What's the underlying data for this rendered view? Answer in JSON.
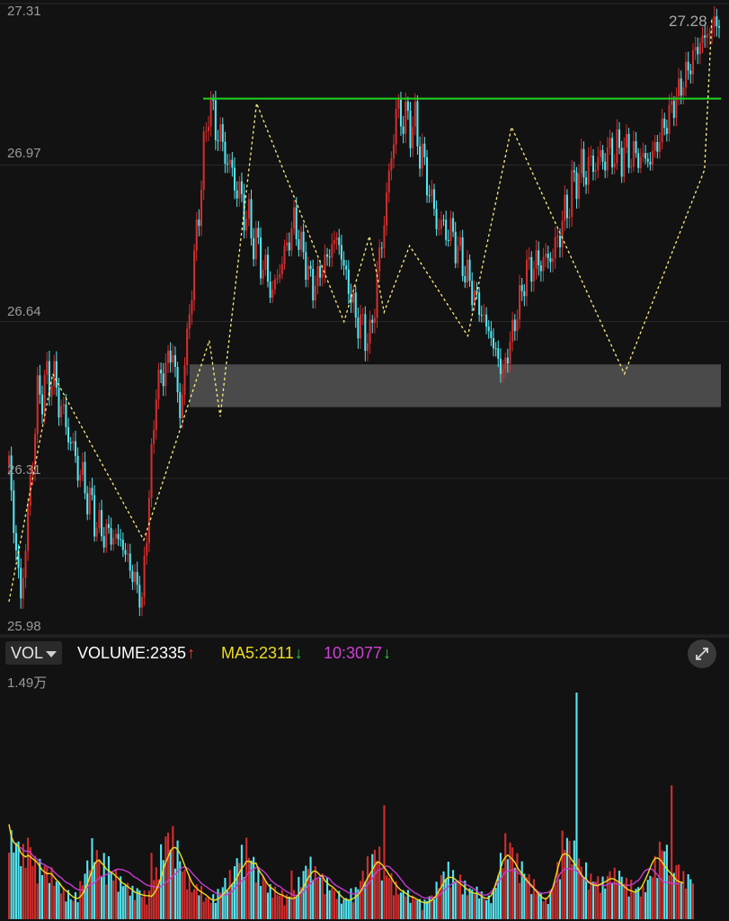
{
  "price_axis": {
    "labels": [
      "27.31",
      "26.97",
      "26.64",
      "26.31",
      "25.98"
    ],
    "ylim": [
      25.98,
      27.31
    ]
  },
  "last_price_label": "27.28",
  "volume_unit_label": "1.49万",
  "indicators": {
    "selector_label": "VOL",
    "volume": {
      "label": "VOLUME:2335",
      "arrow": "↑",
      "color": "#ffffff",
      "arrow_color": "#ff3b30"
    },
    "ma5": {
      "label": "MA5:2311",
      "arrow": "↓",
      "color": "#f0dc1e",
      "arrow_color": "#2ecc40"
    },
    "ma10": {
      "label": "10:3077",
      "arrow": "↓",
      "color": "#d13fd6",
      "arrow_color": "#2ecc40"
    }
  },
  "colors": {
    "up": "#d42d2d",
    "down": "#55e6f0",
    "resistance": "#1fd51f",
    "zone": "#4a4a4a",
    "zigzag": "#ffef80",
    "ma5": "#f0dc1e",
    "ma10": "#c63bd0",
    "grid": "#2a2a2a"
  },
  "chart_data": [
    {
      "type": "line",
      "name": "price-chart",
      "title": "",
      "ylim": [
        25.98,
        27.31
      ],
      "y_ticks": [
        27.31,
        26.97,
        26.64,
        26.31,
        25.98
      ],
      "close_path": {
        "x_index": [
          0,
          5,
          12,
          18,
          28,
          38,
          47,
          56,
          62,
          69,
          72,
          84,
          96,
          111,
          120,
          128,
          138,
          146,
          152,
          159,
          163,
          171,
          180,
          187,
          194,
          202,
          208,
          218,
          229,
          239,
          255,
          270,
          280,
          290,
          299
        ],
        "values": [
          26.33,
          26.05,
          26.48,
          26.53,
          26.35,
          26.2,
          26.18,
          26.05,
          26.5,
          26.58,
          26.44,
          27.1,
          26.92,
          26.7,
          26.85,
          26.71,
          26.82,
          26.65,
          26.6,
          26.9,
          27.08,
          27.05,
          26.85,
          26.82,
          26.72,
          26.62,
          26.53,
          26.75,
          26.78,
          26.95,
          27.0,
          26.98,
          27.1,
          27.22,
          27.28
        ]
      },
      "zigzag_pivots": [
        [
          0,
          26.05
        ],
        [
          12,
          26.53
        ],
        [
          37,
          26.18
        ],
        [
          55,
          26.6
        ],
        [
          58,
          26.44
        ],
        [
          68,
          27.1
        ],
        [
          92,
          26.64
        ],
        [
          99,
          26.82
        ],
        [
          103,
          26.66
        ],
        [
          110,
          26.8
        ],
        [
          126,
          26.61
        ],
        [
          138,
          27.05
        ],
        [
          169,
          26.53
        ],
        [
          191,
          26.96
        ],
        [
          193,
          27.28
        ]
      ],
      "resistance_line": {
        "value": 27.11
      },
      "support_zone": {
        "from": 26.46,
        "to": 26.55
      }
    },
    {
      "type": "bar",
      "name": "volume-chart",
      "title": "",
      "ylim": [
        0,
        14900
      ],
      "bars": [
        6240,
        4570,
        4350,
        4510,
        4150,
        4210,
        3810,
        3790,
        4480,
        4090,
        3680,
        3230,
        3070,
        3160,
        2730,
        3300,
        2710,
        3110,
        2640,
        2310,
        2140,
        2040,
        1900,
        1620,
        1410,
        1560,
        1180,
        1210,
        1390,
        1600,
        1960,
        2210,
        2690,
        3140,
        3890,
        4100,
        4200,
        3800,
        3410,
        2900,
        3370,
        2980,
        3290,
        2890,
        2390,
        2620,
        2360,
        2180,
        2280,
        1910,
        2000,
        1740,
        1690,
        1520,
        1660,
        1710,
        1470,
        1480,
        1380,
        1470,
        1680,
        2310,
        2780,
        3140,
        3790,
        4370,
        4540,
        4920,
        4780,
        4740,
        4360,
        4110,
        3590,
        2950,
        2610,
        2550,
        2180,
        1870,
        1710,
        1920,
        1760,
        1680,
        1390,
        1160,
        1290,
        1070,
        1290,
        1520,
        1560,
        1740,
        1890,
        2210,
        2250,
        2490,
        2600,
        2910,
        3470,
        3880,
        3790,
        3640,
        4260,
        3790,
        3620,
        3260,
        3150,
        2620,
        2300,
        2450,
        2110,
        1950,
        1770,
        1710,
        1740,
        1450,
        1540,
        1500,
        1300,
        1270,
        1470,
        1230,
        1560,
        1790,
        2140,
        2380,
        2650,
        3040,
        3450,
        3180,
        3380,
        2770,
        2490,
        2570,
        2390,
        2150,
        2110,
        2000,
        1770,
        1570,
        1500,
        1430,
        1240,
        1060,
        1250,
        1290,
        1590,
        1580,
        1650,
        1960,
        2260,
        2590,
        2960,
        3180,
        3390,
        3570,
        3950,
        4040,
        3700,
        3340,
        2880,
        2700,
        2560,
        2410,
        2040,
        1930,
        1720,
        1510,
        1600,
        1670,
        1480,
        1300,
        1260,
        1170,
        1230,
        1040,
        870,
        1010,
        1180,
        1350,
        1280,
        1560,
        1900,
        2300,
        2420,
        2720,
        2740,
        2930,
        2760,
        2570,
        2350,
        2350,
        2340,
        2130,
        1960,
        1660,
        1760,
        1630,
        1820,
        1650,
        1650,
        1480,
        1260,
        1230,
        1220,
        1500,
        1580,
        2050,
        2580,
        3550,
        4030,
        4350,
        4440,
        4200,
        4090,
        3540,
        3360,
        3130,
        3020,
        2830,
        2580,
        2360,
        2150,
        2040,
        1790,
        1550,
        1410,
        1320,
        1110,
        1220,
        1510,
        1850,
        2250,
        2950,
        3730,
        4550,
        4530,
        4790,
        4200,
        4330,
        3980,
        3670,
        3330,
        2990,
        2910,
        2890,
        2570,
        2380,
        2320,
        2340,
        2250,
        2260,
        2170,
        2130,
        2450,
        2640,
        2650,
        2610,
        2960,
        2590,
        2520,
        2310,
        2130,
        2120,
        2030,
        1740,
        1790,
        1720,
        1790,
        1700,
        2000,
        2160,
        2470,
        2880,
        3220,
        3570,
        4050,
        4270,
        4180,
        3900,
        3750,
        3380,
        3210,
        3060,
        3010,
        2660,
        2440,
        2440,
        2400,
        2370,
        2310
      ],
      "ma5": [
        6240,
        5405,
        5053,
        4918,
        4764,
        4358,
        4204,
        4094,
        4188,
        4116,
        3970,
        3854,
        3710,
        3446,
        3234,
        3098,
        2994,
        3002,
        2972,
        2770,
        2582,
        2440,
        2206,
        2002,
        1878,
        1740,
        1588,
        1466,
        1384,
        1366,
        1470,
        1674,
        1970,
        2320,
        2778,
        3206,
        3600,
        3830,
        3880,
        3682,
        3536,
        3290,
        3190,
        3086,
        2984,
        2824,
        2708,
        2486,
        2364,
        2270,
        2146,
        2022,
        1924,
        1772,
        1726,
        1666,
        1610,
        1568,
        1540,
        1544,
        1498,
        1664,
        1924,
        2280,
        2740,
        3278,
        3724,
        4108,
        4480,
        4684,
        4712,
        4582,
        4316,
        3950,
        3526,
        3164,
        2776,
        2432,
        2178,
        2050,
        1886,
        1788,
        1690,
        1586,
        1454,
        1320,
        1240,
        1266,
        1346,
        1436,
        1598,
        1784,
        1930,
        2116,
        2310,
        2492,
        2746,
        3060,
        3330,
        3538,
        3808,
        3812,
        3734,
        3628,
        3694,
        3288,
        3038,
        2828,
        2526,
        2286,
        2116,
        1998,
        1856,
        1728,
        1642,
        1588,
        1506,
        1412,
        1416,
        1354,
        1366,
        1464,
        1630,
        1822,
        2104,
        2400,
        2732,
        2940,
        3140,
        3164,
        3056,
        2878,
        2836,
        2534,
        2380,
        2240,
        2156,
        2010,
        1850,
        1656,
        1502,
        1360,
        1296,
        1254,
        1286,
        1356,
        1482,
        1614,
        1802,
        2090,
        2410,
        2710,
        2990,
        3234,
        3534,
        3746,
        3738,
        3594,
        3414,
        3194,
        2912,
        2728,
        2450,
        2236,
        2062,
        1898,
        1836,
        1712,
        1602,
        1502,
        1452,
        1382,
        1296,
        1200,
        1122,
        1080,
        1066,
        1152,
        1246,
        1390,
        1572,
        1852,
        2100,
        2398,
        2626,
        2754,
        2750,
        2736,
        2608,
        2462,
        2336,
        2226,
        2074,
        1964,
        1816,
        1760,
        1696,
        1690,
        1616,
        1516,
        1420,
        1372,
        1410,
        1562,
        1866,
        2364,
        2818,
        3326,
        3830,
        4074,
        4224,
        4082,
        3924,
        3736,
        3424,
        3182,
        2966,
        2752,
        2548,
        2380,
        2224,
        2030,
        1832,
        1660,
        1500,
        1384,
        1316,
        1444,
        1692,
        2090,
        2686,
        3294,
        3860,
        4228,
        4304,
        4252,
        4134,
        3884,
        3692,
        3452,
        3194,
        2928,
        2734,
        2650,
        2450,
        2348,
        2262,
        2220,
        2206,
        2306,
        2374,
        2452,
        2538,
        2660,
        2664,
        2626,
        2514,
        2436,
        2302,
        2152,
        2020,
        1912,
        1876,
        1796,
        1798,
        1874,
        2024,
        2304,
        2634,
        2984,
        3386,
        3750,
        3996,
        4028,
        3944,
        3760,
        3516,
        3314,
        3130,
        2948,
        2784,
        2564,
        2472,
        2436,
        2384
      ],
      "ma10": [
        6240,
        5405,
        5053,
        4918,
        4764,
        4689,
        4563,
        4467,
        4469,
        4431,
        4177,
        4042,
        3914,
        3779,
        3645,
        3583,
        3473,
        3405,
        3286,
        3109,
        2955,
        2836,
        2719,
        2565,
        2430,
        2357,
        2268,
        2148,
        2023,
        1944,
        1913,
        1930,
        1998,
        2104,
        2253,
        2307,
        2396,
        2556,
        2699,
        2829,
        2858,
        2935,
        3005,
        3089,
        3164,
        3265,
        3293,
        3272,
        3248,
        3179,
        3123,
        3024,
        2873,
        2758,
        2683,
        2567,
        2459,
        2341,
        2251,
        2197,
        2170,
        2131,
        2124,
        2077,
        2147,
        2283,
        2407,
        2534,
        2681,
        2842,
        2947,
        3127,
        3284,
        3403,
        3428,
        3369,
        3245,
        3052,
        2873,
        2710,
        2534,
        2360,
        2243,
        2147,
        2029,
        1912,
        1823,
        1731,
        1622,
        1585,
        1567,
        1612,
        1628,
        1716,
        1825,
        2004,
        2222,
        2358,
        2502,
        2609,
        2889,
        3047,
        3193,
        3285,
        3388,
        3418,
        3278,
        3175,
        3011,
        2846,
        2609,
        2460,
        2341,
        2213,
        2160,
        2020,
        1917,
        1805,
        1722,
        1641,
        1580,
        1571,
        1618,
        1705,
        1815,
        1975,
        2172,
        2330,
        2524,
        2643,
        2700,
        2797,
        2880,
        2823,
        2752,
        2664,
        2450,
        2308,
        2188,
        2104,
        2012,
        1924,
        1834,
        1734,
        1674,
        1660,
        1687,
        1722,
        1821,
        1945,
        2079,
        2268,
        2454,
        2652,
        2942,
        3176,
        3250,
        3322,
        3445,
        3496,
        3457,
        3325,
        3166,
        3034,
        2833,
        2638,
        2438,
        2216,
        2086,
        1958,
        1839,
        1718,
        1654,
        1557,
        1446,
        1403,
        1395,
        1400,
        1413,
        1445,
        1472,
        1575,
        1705,
        1855,
        1990,
        2153,
        2268,
        2355,
        2452,
        2500,
        2481,
        2446,
        2337,
        2244,
        2168,
        2078,
        1948,
        1866,
        1723,
        1649,
        1593,
        1594,
        1668,
        1780,
        1981,
        2216,
        2447,
        2650,
        2883,
        3105,
        3154,
        3221,
        3231,
        3203,
        3126,
        2977,
        2846,
        2719,
        2541,
        2309,
        2144,
        2036,
        1923,
        1783,
        1713,
        1706,
        1738,
        1754,
        1876,
        2062,
        2367,
        2656,
        2981,
        3165,
        3302,
        3327,
        3319,
        3297,
        3223,
        3197,
        3011,
        2869,
        2727,
        2527,
        2392,
        2380,
        2331,
        2330,
        2255,
        2264,
        2219,
        2207,
        2298,
        2355,
        2366,
        2371,
        2310,
        2279,
        2289,
        2236,
        2214,
        2232,
        2277,
        2318,
        2468,
        2548,
        2754,
        3021,
        3216,
        3282,
        3322,
        3251,
        3098,
        2929,
        2717,
        2539,
        2436,
        2413,
        2406,
        2356,
        2324,
        2350,
        2307
      ]
    }
  ]
}
